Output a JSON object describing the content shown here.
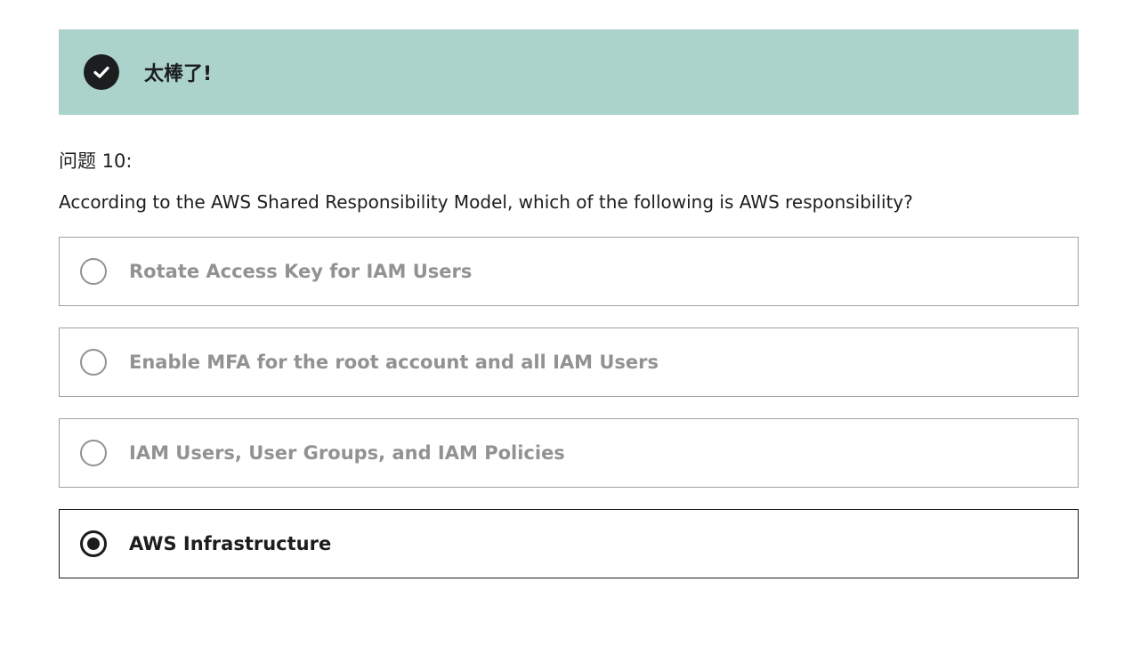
{
  "banner": {
    "text": "太棒了!",
    "icon": "check-circle-icon",
    "background": "#acd2cc"
  },
  "question": {
    "number_label": "问题 10:",
    "text": "According to the AWS Shared Responsibility Model, which of the following is AWS responsibility?"
  },
  "options": [
    {
      "label": "Rotate Access Key for IAM Users",
      "selected": false
    },
    {
      "label": "Enable MFA for the root account and all IAM Users",
      "selected": false
    },
    {
      "label": "IAM Users, User Groups, and IAM Policies",
      "selected": false
    },
    {
      "label": "AWS Infrastructure",
      "selected": true
    }
  ],
  "colors": {
    "text": "#1c1d1f",
    "muted": "#929292",
    "border": "#9da3a6"
  }
}
